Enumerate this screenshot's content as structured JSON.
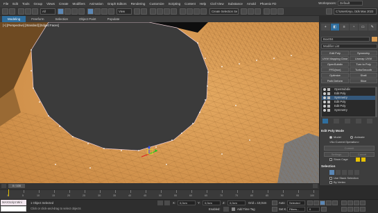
{
  "menubar": {
    "items": [
      "File",
      "Edit",
      "Tools",
      "Group",
      "Views",
      "Create",
      "Modifiers",
      "Animation",
      "Graph Editors",
      "Rendering",
      "Customize",
      "Scripting",
      "Content",
      "Help",
      "Civil View",
      "Substance",
      "Arnold",
      "Phoenix FD"
    ],
    "workspaces_label": "Workspaces:",
    "workspaces_value": "Default"
  },
  "toolbar": {
    "view_dropdown": "View",
    "selection_set": "Create Selection Se",
    "project_path": "C:\\Users\\Ayu..\\3ds Max 2023"
  },
  "ribbon": {
    "tabs": [
      "Modeling",
      "Freeform",
      "Selection",
      "Object Paint",
      "Populate"
    ],
    "active": "Modeling"
  },
  "viewport": {
    "label": "[+] [Perspective] [Standard] [Edged Faces]"
  },
  "cmdpanel": {
    "tabs": [
      "+",
      "◧",
      "≡",
      "◔",
      "▭",
      "✎"
    ],
    "object_name": "Box004",
    "modifier_list": "Modifier List",
    "buttons": [
      [
        "Edit Poly",
        "Symmetry"
      ],
      [
        "UVW Mapping Clear",
        "Unwrap UVW"
      ],
      [
        "OpenSubdiv",
        "Turn to Poly"
      ],
      [
        "FFD(box)",
        "TurboSmooth"
      ],
      [
        "Optimize",
        "Shell"
      ],
      [
        "Path Deform",
        "Slice"
      ]
    ],
    "stack": [
      "OpenSubdiv",
      "Edit Poly",
      "Symmetry",
      "Edit Poly",
      "Edit Poly",
      "Symmetry"
    ],
    "selected_stack_index": 2,
    "edit_poly_mode": {
      "title": "Edit Poly Mode",
      "model": "Model",
      "animate": "Animate",
      "current_op": "<No Current Operation>",
      "commit": "Commit",
      "settings": "Settings",
      "cancel": "Cancel",
      "show_cage": "Show Cage"
    },
    "selection": {
      "title": "Selection",
      "use_stack": "Use Stack Selection",
      "by_vertex": "By Vertex"
    }
  },
  "timeline": {
    "frame": "0 / 100",
    "ticks": [
      "0",
      "5",
      "10",
      "15",
      "20",
      "25",
      "30",
      "35",
      "40",
      "45",
      "50",
      "55",
      "60",
      "65",
      "70",
      "75",
      "80",
      "85",
      "90",
      "95",
      "100"
    ]
  },
  "statusbar": {
    "maxscript": "MAXScript Mini",
    "status": "1 Object Selected",
    "hint": "Click or click-and-drag to select objects",
    "x_label": "X:",
    "x_value": "0,0cm",
    "y_label": "Y:",
    "y_value": "0,0cm",
    "z_label": "Z:",
    "z_value": "0,0cm",
    "grid": "Grid = 10,0cm",
    "enabled": "Enabled:",
    "add_time_tag": "Add Time Tag",
    "auto": "Auto",
    "selected": "Selected",
    "set_k": "Set K.",
    "filters": "Filters...",
    "frame_value": "0"
  },
  "colors": {
    "accent": "#2f6e9e",
    "mesh": "#d79a52",
    "hole": "#3a3a3a"
  }
}
